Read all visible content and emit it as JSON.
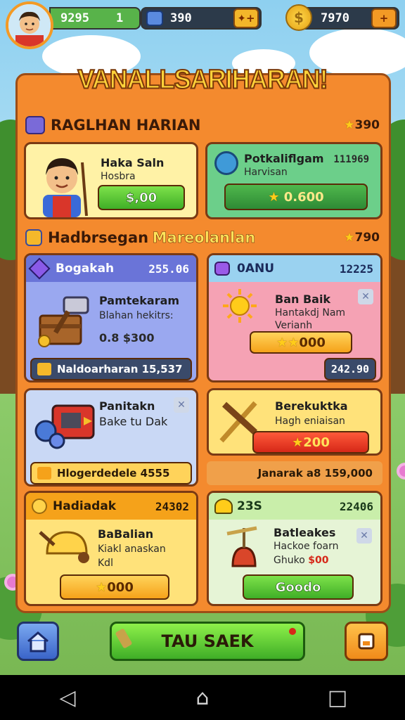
{
  "stats": {
    "gems": "9295",
    "level": "1",
    "tickets": "390",
    "coins": "7970",
    "plus_label": "+"
  },
  "title": "VANALLSARIHARAN!",
  "section1": {
    "label": "RAGLHAN HARIAN",
    "value": "390"
  },
  "section2": {
    "label": "Hadbrsegan",
    "label_accent": "Mareolanlan",
    "value": "790"
  },
  "cards": {
    "c1": {
      "title": "Haka Saln",
      "subtitle": "Hosbra",
      "button": "$,00"
    },
    "c2": {
      "title": "Potkaliflgam",
      "subtitle": "Harvisan",
      "value": "111969",
      "button": "0.600"
    },
    "c3": {
      "head": "Bogakah",
      "head_value": "255.06",
      "title": "Pamtekaram",
      "desc": "Blahan hekitrs:",
      "price": "0.8 $300",
      "footer": "Naldoarharan 15,537"
    },
    "c4": {
      "head": "0ANU",
      "head_value": "12225",
      "title": "Ban Baik",
      "desc1": "Hantakdj Nam",
      "desc2": "Verianh",
      "button": "000",
      "footer_value": "242.90"
    },
    "c5": {
      "title": "Panitakn",
      "desc": "Bake tu Dak",
      "footer": "Hlogerdedele 4555"
    },
    "c6": {
      "title": "Berekuktka",
      "desc": "Hagh eniaisan",
      "button": "200"
    },
    "c7": {
      "head": "Hadiadak",
      "head_value": "24302",
      "title": "BaBalian",
      "desc1": "Kiakl anaskan",
      "desc2": "Kdl",
      "button": "000"
    },
    "c8": {
      "head": "23S",
      "head_value": "22406",
      "title": "Batleakes",
      "desc1": "Hackoe foarn",
      "desc2": "Ghuko",
      "price": "$00",
      "button": "Goodo"
    }
  },
  "summary_row": "Janarak a8 159,000",
  "bottom": {
    "play_label": "TAU SAEK",
    "home_icon": "home-icon",
    "menu_icon": "bag-icon"
  },
  "colors": {
    "panel": "#f48a2e",
    "accent_green": "#58b34a",
    "accent_orange": "#f39a25"
  }
}
